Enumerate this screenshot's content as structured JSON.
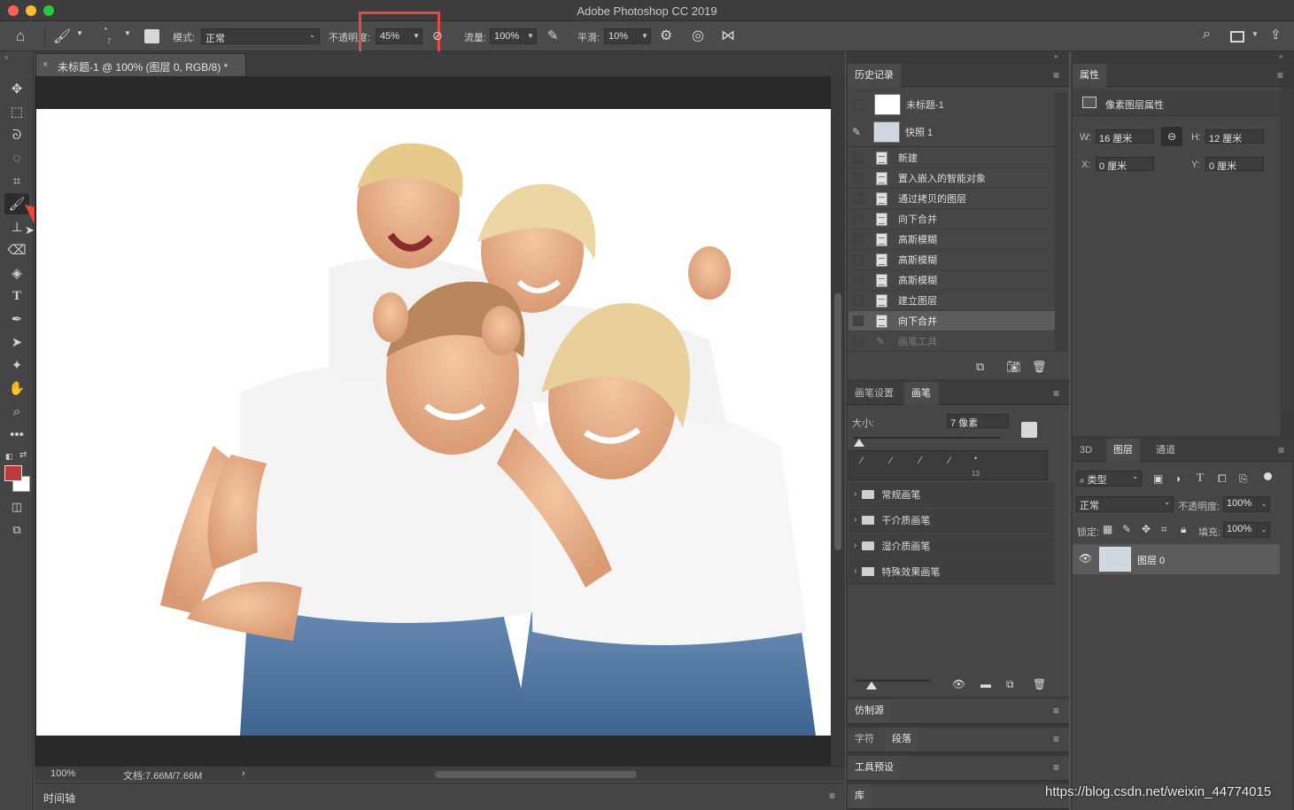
{
  "window": {
    "title": "Adobe Photoshop CC 2019"
  },
  "options_bar": {
    "brush_size": "7",
    "mode_label": "模式:",
    "mode_value": "正常",
    "opacity_label": "不透明度:",
    "opacity_value": "45%",
    "flow_label": "流量:",
    "flow_value": "100%",
    "smoothing_label": "平滑:",
    "smoothing_value": "10%"
  },
  "document": {
    "tab_title": "未标题-1 @ 100% (图层 0, RGB/8) *",
    "zoom": "100%",
    "doc_size": "文档:7.66M/7.66M",
    "timeline_label": "时间轴"
  },
  "history_panel": {
    "title": "历史记录",
    "snapshot_doc": "未标题-1",
    "snapshot_1": "快照 1",
    "items": [
      "新建",
      "置入嵌入的智能对象",
      "通过拷贝的图层",
      "向下合并",
      "高斯模糊",
      "高斯模糊",
      "高斯模糊",
      "建立图层",
      "向下合并",
      "画笔工具"
    ]
  },
  "brush_panel": {
    "tabs": [
      "画笔设置",
      "画笔"
    ],
    "size_label": "大小:",
    "size_value": "7 像素",
    "preset_size": "13",
    "folders": [
      "常规画笔",
      "干介质画笔",
      "湿介质画笔",
      "特殊效果画笔"
    ]
  },
  "collapsed_panels": {
    "clone_source": "仿制源",
    "char_tabs": [
      "字符",
      "段落"
    ],
    "tool_presets": "工具预设",
    "library": "库"
  },
  "properties_panel": {
    "title": "属性",
    "subtitle": "像素图层属性",
    "w_label": "W:",
    "w_value": "16 厘米",
    "h_label": "H:",
    "h_value": "12 厘米",
    "x_label": "X:",
    "x_value": "0 厘米",
    "y_label": "Y:",
    "y_value": "0 厘米"
  },
  "layers_panel": {
    "tabs": [
      "3D",
      "图层",
      "通道"
    ],
    "filter_label": "类型",
    "blend_mode": "正常",
    "opacity_label": "不透明度:",
    "opacity_value": "100%",
    "lock_label": "锁定:",
    "fill_label": "填充:",
    "fill_value": "100%",
    "layer_name": "图层 0"
  },
  "watermark": "https://blog.csdn.net/weixin_44774015",
  "colors": {
    "foreground": "#c03a3a",
    "background": "#ffffff",
    "highlight_box": "#e8493f",
    "arrow": "#e8493f"
  }
}
